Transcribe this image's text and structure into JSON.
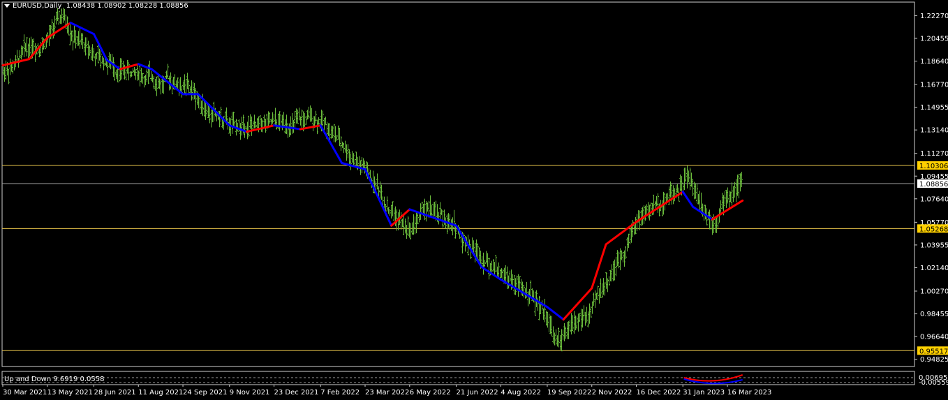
{
  "header": {
    "symbol": "EURUSD,Daily",
    "ohlc": "1.08438 1.08902 1.08228 1.08856"
  },
  "indicator": {
    "label": "Up and Down 9.6919 0.0558"
  },
  "colors": {
    "background": "#000000",
    "bars": "#6bbd3c",
    "trend_up": "#0000ff",
    "trend_down": "#ff0000",
    "level_line": "#e6c34a",
    "level_label_bg": "#ffd000",
    "current_price_line": "#a0a0a0",
    "axis_text": "#ffffff"
  },
  "chart_data": {
    "type": "line",
    "title": "EURUSD,Daily",
    "xlabel": "",
    "ylabel": "",
    "ylim": [
      0.9425,
      1.2335
    ],
    "y_ticks": [
      1.2227,
      1.20455,
      1.1864,
      1.1677,
      1.14955,
      1.1314,
      1.1127,
      1.09455,
      1.0764,
      1.0577,
      1.03955,
      1.0214,
      1.0027,
      0.98455,
      0.9664,
      0.94825
    ],
    "x_ticks": [
      "30 Mar 2021",
      "13 May 2021",
      "28 Jun 2021",
      "11 Aug 2021",
      "24 Sep 2021",
      "9 Nov 2021",
      "23 Dec 2021",
      "7 Feb 2022",
      "23 Mar 2022",
      "6 May 2022",
      "21 Jun 2022",
      "4 Aug 2022",
      "19 Sep 2022",
      "2 Nov 2022",
      "16 Dec 2022",
      "31 Jan 2023",
      "16 Mar 2023"
    ],
    "price_points": [
      [
        "30 Mar 2021",
        1.178
      ],
      [
        "13 May 2021",
        1.208
      ],
      [
        "28 May 2021",
        1.221
      ],
      [
        "28 Jun 2021",
        1.19
      ],
      [
        "11 Aug 2021",
        1.175
      ],
      [
        "24 Sep 2021",
        1.168
      ],
      [
        "9 Nov 2021",
        1.132
      ],
      [
        "23 Dec 2021",
        1.133
      ],
      [
        "7 Feb 2022",
        1.14
      ],
      [
        "23 Mar 2022",
        1.1
      ],
      [
        "6 May 2022",
        1.05
      ],
      [
        "21 May 2022",
        1.068
      ],
      [
        "21 Jun 2022",
        1.05
      ],
      [
        "4 Aug 2022",
        1.02
      ],
      [
        "19 Sep 2022",
        0.985
      ],
      [
        "28 Sep 2022",
        0.962
      ],
      [
        "2 Nov 2022",
        0.985
      ],
      [
        "16 Dec 2022",
        1.06
      ],
      [
        "31 Jan 2023",
        1.09
      ],
      [
        "2 Feb 2023",
        1.097
      ],
      [
        "1 Mar 2023",
        1.062
      ],
      [
        "16 Mar 2023",
        1.08
      ],
      [
        "31 Mar 2023",
        1.08856
      ]
    ],
    "series": [
      {
        "values": [
          1.183,
          1.188,
          1.205,
          1.217,
          1.208,
          1.187,
          1.18,
          1.184,
          1.18,
          1.16,
          1.16,
          1.135,
          1.13,
          1.135,
          1.132,
          1.135,
          1.105,
          1.1,
          1.055,
          1.068,
          1.055,
          1.022,
          1.012,
          0.99,
          0.98,
          1.005,
          1.04,
          1.058,
          1.082,
          1.07,
          1.06,
          1.075
        ],
        "x": [
          "30 Mar 2021",
          "25 Apr 2021",
          "13 May 2021",
          "5 Jun 2021",
          "28 Jun 2021",
          "11 Jul 2021",
          "24 Jul 2021",
          "11 Aug 2021",
          "24 Aug 2021",
          "24 Sep 2021",
          "9 Oct 2021",
          "9 Nov 2021",
          "26 Nov 2021",
          "23 Dec 2021",
          "18 Jan 2022",
          "7 Feb 2022",
          "28 Feb 2022",
          "23 Mar 2022",
          "18 Apr 2022",
          "6 May 2022",
          "21 Jun 2022",
          "16 Jul 2022",
          "4 Aug 2022",
          "19 Sep 2022",
          "5 Oct 2022",
          "2 Nov 2022",
          "16 Nov 2022",
          "16 Dec 2022",
          "31 Jan 2023",
          "10 Feb 2023",
          "1 Mar 2023",
          "31 Mar 2023"
        ]
      }
    ],
    "horizontal_levels": [
      1.10306,
      1.05268,
      0.95517
    ],
    "level_labels": [
      "1.10306",
      "1.05268",
      "0.95517"
    ],
    "current_price": 1.08856,
    "current_price_label": "1.08856",
    "indicator_scale_labels": [
      "0.00695",
      "-0.00559"
    ],
    "grid": false,
    "legend": "none"
  }
}
